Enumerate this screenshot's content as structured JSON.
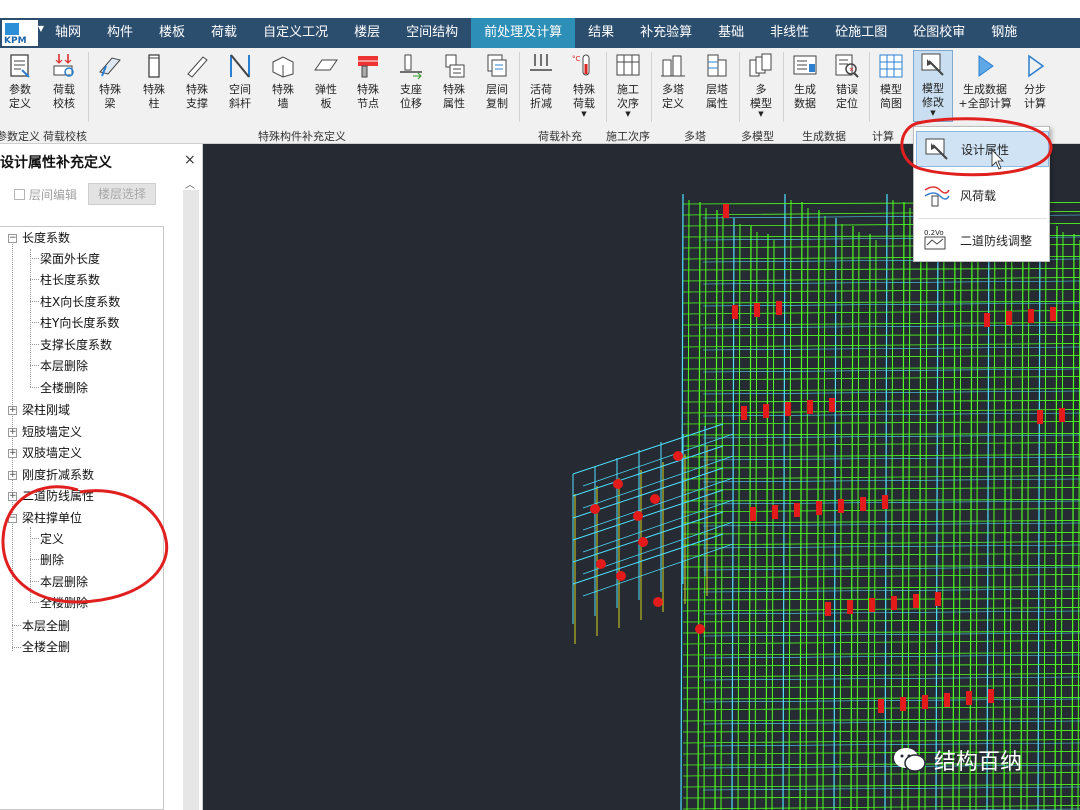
{
  "menubar": {
    "logo_text": "KPM",
    "items": [
      "轴网",
      "构件",
      "楼板",
      "荷载",
      "自定义工况",
      "楼层",
      "空间结构",
      "前处理及计算",
      "结果",
      "补充验算",
      "基础",
      "非线性",
      "砼施工图",
      "砼图校审",
      "钢施"
    ],
    "active_index": 7
  },
  "ribbon": {
    "buttons": [
      {
        "label1": "参数",
        "label2": "定义",
        "icon": "param-icon"
      },
      {
        "label1": "荷载",
        "label2": "校核",
        "icon": "load-check-icon"
      },
      {
        "label1": "特殊",
        "label2": "梁",
        "icon": "special-beam-icon"
      },
      {
        "label1": "特殊",
        "label2": "柱",
        "icon": "special-column-icon"
      },
      {
        "label1": "特殊",
        "label2": "支撑",
        "icon": "special-brace-icon"
      },
      {
        "label1": "空间",
        "label2": "斜杆",
        "icon": "space-bar-icon"
      },
      {
        "label1": "特殊",
        "label2": "墙",
        "icon": "special-wall-icon"
      },
      {
        "label1": "弹性",
        "label2": "板",
        "icon": "elastic-slab-icon"
      },
      {
        "label1": "特殊",
        "label2": "节点",
        "icon": "special-node-icon"
      },
      {
        "label1": "支座",
        "label2": "位移",
        "icon": "support-disp-icon"
      },
      {
        "label1": "特殊",
        "label2": "属性",
        "icon": "special-attr-icon"
      },
      {
        "label1": "层间",
        "label2": "复制",
        "icon": "floor-copy-icon"
      },
      {
        "label1": "活荷",
        "label2": "折减",
        "icon": "live-load-reduce-icon"
      },
      {
        "label1": "特殊",
        "label2": "荷载",
        "icon": "special-load-icon"
      },
      {
        "label1": "施工",
        "label2": "次序",
        "icon": "construction-order-icon"
      },
      {
        "label1": "多塔",
        "label2": "定义",
        "icon": "multi-tower-def-icon"
      },
      {
        "label1": "层塔",
        "label2": "属性",
        "icon": "floor-tower-attr-icon"
      },
      {
        "label1": "多",
        "label2": "模型",
        "icon": "multi-model-icon"
      },
      {
        "label1": "生成",
        "label2": "数据",
        "icon": "gen-data-icon"
      },
      {
        "label1": "错误",
        "label2": "定位",
        "icon": "error-locate-icon"
      },
      {
        "label1": "模型",
        "label2": "简图",
        "icon": "model-sketch-icon"
      },
      {
        "label1": "模型",
        "label2": "修改",
        "icon": "model-modify-icon"
      },
      {
        "label1": "生成数据",
        "label2": "+全部计算",
        "icon": "gen-calc-all-icon"
      },
      {
        "label1": "分步",
        "label2": "计算",
        "icon": "step-calc-icon"
      }
    ],
    "groups": [
      "参数定义",
      "荷载校核",
      "特殊构件补充定义",
      "荷载补充",
      "施工次序",
      "多塔",
      "多模型",
      "生成数据",
      "计算"
    ]
  },
  "panel": {
    "title": "设计属性补充定义",
    "close": "×",
    "checkbox_label": "层间编辑",
    "floor_select": "楼层选择",
    "tree": {
      "length_coef": "长度系数",
      "length_children": [
        "梁面外长度",
        "柱长度系数",
        "柱X向长度系数",
        "柱Y向长度系数",
        "支撑长度系数",
        "本层删除",
        "全楼删除"
      ],
      "beam_col_rigid": "梁柱刚域",
      "short_wall": "短肢墙定义",
      "double_wall": "双肢墙定义",
      "stiffness_reduce": "刚度折减系数",
      "second_defense": "二道防线属性",
      "unit": "梁柱撑单位",
      "unit_children": [
        "定义",
        "删除",
        "本层删除",
        "全楼删除"
      ],
      "floor_delete_all": "本层全删",
      "building_delete_all": "全楼全删"
    }
  },
  "popup": {
    "items": [
      {
        "label": "设计属性",
        "icon": "design-attr-icon"
      },
      {
        "label": "风荷载",
        "icon": "wind-load-icon"
      },
      {
        "label": "二道防线调整",
        "icon": "second-defense-adjust-icon",
        "badge": "0.2Vo"
      }
    ]
  },
  "watermark": {
    "text": "结构百纳"
  },
  "colors": {
    "menubar": "#2b4d6e",
    "active_tab": "#2d8fb7",
    "viewport": "#262a33",
    "annotation": "#e0201e",
    "frame_green": "#4cff1e",
    "frame_cyan": "#4ee0ff",
    "node_red": "#e31b1b"
  }
}
